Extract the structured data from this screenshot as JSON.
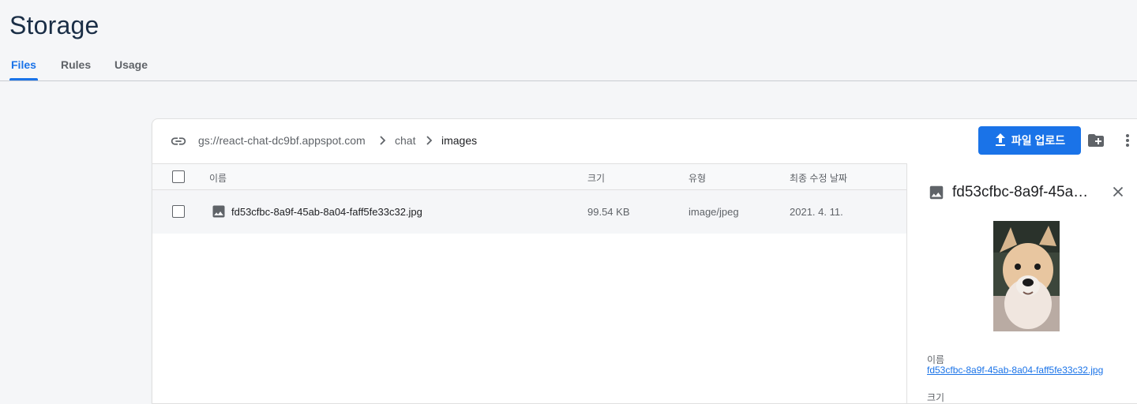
{
  "page": {
    "title": "Storage"
  },
  "tabs": [
    {
      "label": "Files",
      "active": true
    },
    {
      "label": "Rules",
      "active": false
    },
    {
      "label": "Usage",
      "active": false
    }
  ],
  "toolbar": {
    "breadcrumb": [
      "gs://react-chat-dc9bf.appspot.com",
      "chat",
      "images"
    ],
    "upload_label": "파일 업로드",
    "icons": [
      "link-icon",
      "upload-icon",
      "create-folder-icon",
      "more-vert-icon"
    ]
  },
  "table": {
    "columns": [
      "이름",
      "크기",
      "유형",
      "최종 수정 날짜"
    ],
    "rows": [
      {
        "name": "fd53cfbc-8a9f-45ab-8a04-faff5fe33c32.jpg",
        "size": "99.54 KB",
        "type": "image/jpeg",
        "modified": "2021. 4. 11."
      }
    ]
  },
  "detail_panel": {
    "title": "fd53cfbc-8a9f-45a…",
    "name_label": "이름",
    "name_value": "fd53cfbc-8a9f-45ab-8a04-faff5fe33c32.jpg",
    "next_label": "크기"
  },
  "colors": {
    "accent": "#1a73e8",
    "background": "#f5f6f8",
    "title": "#1a2e46"
  }
}
